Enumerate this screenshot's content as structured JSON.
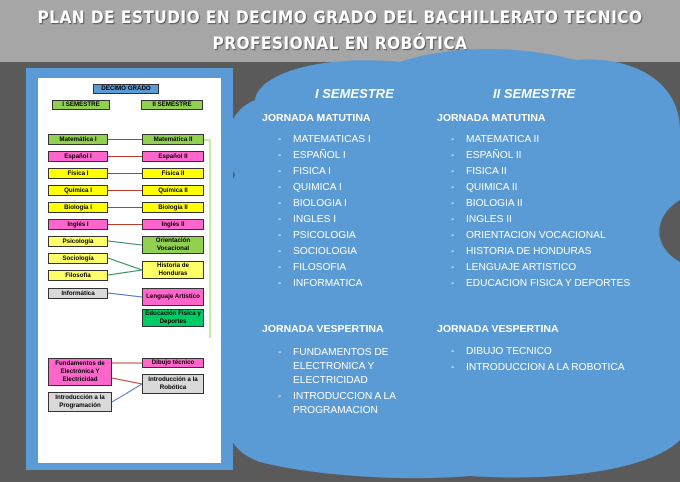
{
  "title": "PLAN DE ESTUDIO EN DECIMO GRADO DEL BACHILLERATO TECNICO PROFESIONAL EN ROBÓTICA",
  "colors": {
    "background": "#5a5a5a",
    "title_bar": "#a6a6a6",
    "blob": "#5b9bd5",
    "text": "#ffffff"
  },
  "diagram": {
    "header": "DECIMO GRADO",
    "sem1": "I SEMESTRE",
    "sem2": "II SEMESTRE",
    "left": [
      {
        "label": "Matemática I",
        "color": "#92d050"
      },
      {
        "label": "Español I",
        "color": "#ff66cc"
      },
      {
        "label": "Física I",
        "color": "#ffff00"
      },
      {
        "label": "Química I",
        "color": "#ffff00"
      },
      {
        "label": "Biología I",
        "color": "#ffff00"
      },
      {
        "label": "Inglés I",
        "color": "#ff66cc"
      },
      {
        "label": "Psicología",
        "color": "#ffff66"
      },
      {
        "label": "Sociología",
        "color": "#ffff66"
      },
      {
        "label": "Filosofía",
        "color": "#ffff66"
      },
      {
        "label": "Informática",
        "color": "#d9d9d9"
      }
    ],
    "right": [
      {
        "label": "Matemática II",
        "color": "#92d050"
      },
      {
        "label": "Español II",
        "color": "#ff66cc"
      },
      {
        "label": "Física II",
        "color": "#ffff00"
      },
      {
        "label": "Química II",
        "color": "#ffff00"
      },
      {
        "label": "Biología II",
        "color": "#ffff00"
      },
      {
        "label": "Inglés II",
        "color": "#ff66cc"
      },
      {
        "label": "Orientación Vocacional",
        "color": "#92d050"
      },
      {
        "label": "Historia de Honduras",
        "color": "#ffff66"
      },
      {
        "label": "Lenguaje Artístico",
        "color": "#ff66cc"
      },
      {
        "label": "Educación Física y Deportes",
        "color": "#00cc66"
      }
    ],
    "tech_left": [
      {
        "label": "Fundamentos de Electrónica Y Electricidad",
        "color": "#ff66cc"
      },
      {
        "label": "Introducción a la Programación",
        "color": "#d9d9d9"
      }
    ],
    "tech_right": [
      {
        "label": "Dibujo técnico",
        "color": "#ff66cc"
      },
      {
        "label": "Introducción a la Robótica",
        "color": "#d9d9d9"
      }
    ]
  },
  "semester1": {
    "heading": "I SEMESTRE",
    "matutina": {
      "heading": "JORNADA MATUTINA",
      "items": [
        "MATEMATICAS I",
        "ESPAÑOL I",
        "FISICA I",
        "QUIMICA I",
        "BIOLOGIA I",
        "INGLES I",
        "PSICOLOGIA",
        "SOCIOLOGIA",
        "FILOSOFIA",
        "INFORMATICA"
      ]
    },
    "vespertina": {
      "heading": "JORNADA VESPERTINA",
      "items": [
        "FUNDAMENTOS DE ELECTRONICA Y ELECTRICIDAD",
        "INTRODUCCION A LA PROGRAMACION"
      ]
    }
  },
  "semester2": {
    "heading": "II SEMESTRE",
    "matutina": {
      "heading": "JORNADA MATUTINA",
      "items": [
        "MATEMATICA II",
        "ESPAÑOL II",
        "FISICA II",
        "QUIMICA II",
        "BIOLOGIA II",
        "INGLES II",
        "ORIENTACION VOCACIONAL",
        "HISTORIA DE HONDURAS",
        "LENGUAJE ARTISTICO",
        "EDUCACION FISICA Y DEPORTES"
      ]
    },
    "vespertina": {
      "heading": "JORNADA VESPERTINA",
      "items": [
        "DIBUJO TECNICO",
        "INTRODUCCION A LA ROBOTICA"
      ]
    }
  }
}
